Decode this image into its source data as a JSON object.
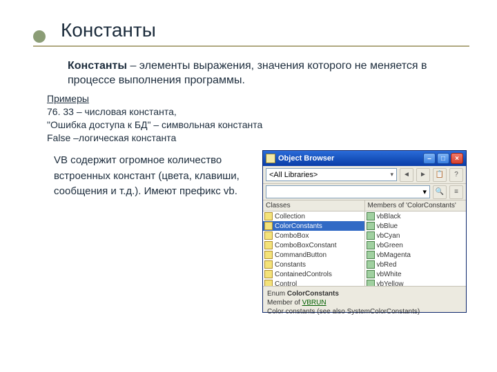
{
  "slide": {
    "title": "Константы",
    "definition_bold": "Константы",
    "definition_rest": " – элементы выражения, значения которого не меняется в процессе выполнения программы.",
    "examples_heading": "Примеры",
    "example1": "76. 33 – числовая константа,",
    "example2": "\"Ошибка доступа к БД\" – символьная константа",
    "example3": "False –логическая константа",
    "vb_paragraph": "VB содержит огромное количество встроенных констант (цвета, клавиши, сообщения и т.д.). Имеют префикс vb."
  },
  "browser": {
    "title": "Object Browser",
    "library_selected": "<All Libraries>",
    "search_placeholder": "",
    "pane_classes_header": "Classes",
    "pane_members_header": "Members of 'ColorConstants'",
    "classes": [
      "Collection",
      "ColorConstants",
      "ComboBox",
      "ComboBoxConstant",
      "CommandButton",
      "Constants",
      "ContainedControls",
      "Control"
    ],
    "classes_selected_index": 1,
    "members": [
      "vbBlack",
      "vbBlue",
      "vbCyan",
      "vbGreen",
      "vbMagenta",
      "vbRed",
      "vbWhite",
      "vbYellow"
    ],
    "detail_line1_prefix": "Enum ",
    "detail_line1_bold": "ColorConstants",
    "detail_line2_prefix": "Member of ",
    "detail_line2_link": "VBRUN",
    "detail_line3": "Color constants (see also SystemColorConstants)"
  }
}
